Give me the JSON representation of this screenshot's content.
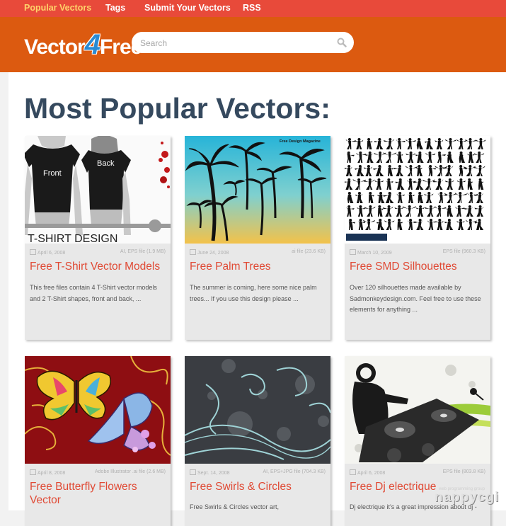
{
  "nav": {
    "items": [
      {
        "label": "Popular Vectors",
        "active": true
      },
      {
        "label": "Tags",
        "active": false
      },
      {
        "label": "Submit Your Vectors",
        "active": false
      },
      {
        "label": "RSS",
        "active": false
      }
    ]
  },
  "header": {
    "logo": {
      "part1": "Vector",
      "part2": "4",
      "part3": "Free"
    },
    "search_placeholder": "Search",
    "search_icon": "magnifier-icon"
  },
  "page": {
    "title": "Most Popular Vectors:"
  },
  "cards": [
    {
      "image_text": "T-SHIRT DESIGN",
      "shirt_front": "Front",
      "shirt_back": "Back",
      "date": "April 6, 2008",
      "filetype": "AI, EPS file (1.9 MB)",
      "title": "Free T-Shirt Vector Models",
      "excerpt": "This free files contain 4 T-Shirt vector models and 2 T-Shirt shapes, front and back, ..."
    },
    {
      "image_text": "Free Design Magazine",
      "date": "June 24, 2008",
      "filetype": "ai file (23.6 KB)",
      "title": "Free Palm Trees",
      "excerpt": "The summer is coming, here some nice palm trees... If you use this design please ..."
    },
    {
      "date": "March 10, 2009",
      "filetype": "EPS file (960.3 KB)",
      "title": "Free SMD Silhouettes",
      "excerpt": "Over 120 silhouettes made available by Sadmonkeydesign.com. Feel free to use these elements for anything ..."
    },
    {
      "date": "April 8, 2008",
      "filetype": "Adobe Illustrator .ai file (2.6 MB)",
      "title": "Free Butterfly Flowers Vector",
      "excerpt": ""
    },
    {
      "date": "Sept. 14, 2008",
      "filetype": "AI, EPS+JPG file (704.3 KB)",
      "title": "Free Swirls & Circles",
      "excerpt": "Free Swirls & Circles vector art,"
    },
    {
      "date": "April 6, 2008",
      "filetype": "EPS file (803.8 KB)",
      "title": "Free Dj electrique",
      "excerpt": "Dj electrique it's a great impression about dj -"
    }
  ],
  "watermark": {
    "small": "web programming group",
    "large": "nappycgi"
  },
  "colors": {
    "topnav": "#e84a3a",
    "header": "#dc5a10",
    "nav_active": "#ffd36a",
    "title": "#35495e",
    "card_title": "#e04a35"
  }
}
